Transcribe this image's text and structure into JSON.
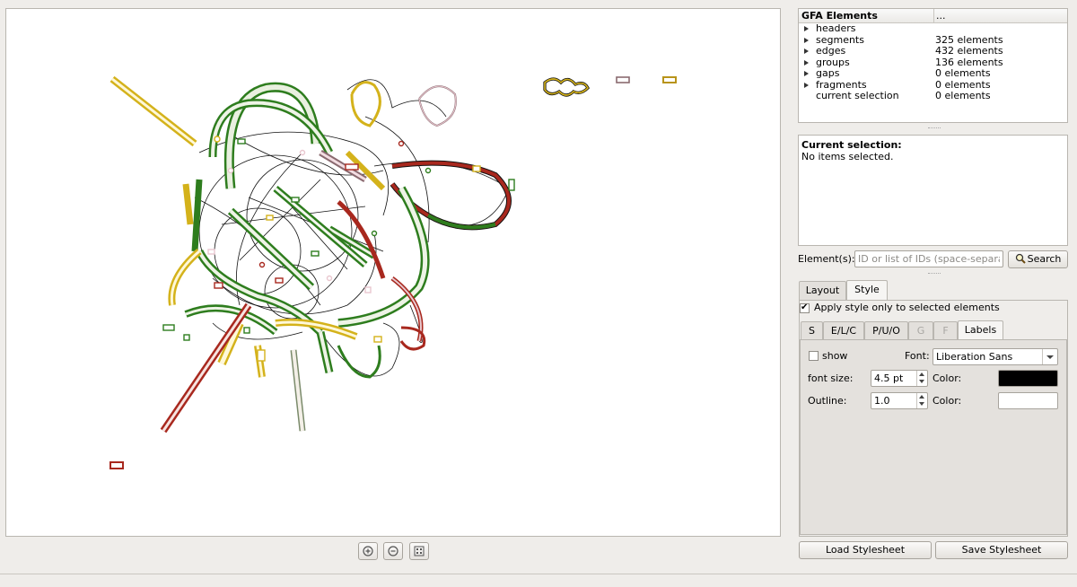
{
  "tree": {
    "header_col1": "GFA Elements",
    "header_col2": "...",
    "rows": [
      {
        "label": "headers",
        "count": "",
        "expandable": true
      },
      {
        "label": "segments",
        "count": "325 elements",
        "expandable": true
      },
      {
        "label": "edges",
        "count": "432 elements",
        "expandable": true
      },
      {
        "label": "groups",
        "count": "136 elements",
        "expandable": true
      },
      {
        "label": "gaps",
        "count": "0 elements",
        "expandable": true
      },
      {
        "label": "fragments",
        "count": "0 elements",
        "expandable": true
      },
      {
        "label": "current selection",
        "count": "0 elements",
        "expandable": false
      }
    ]
  },
  "selection": {
    "title": "Current selection:",
    "text": "No items selected."
  },
  "search": {
    "label": "Element(s):",
    "placeholder": "ID or list of IDs (space-separa...",
    "button": "Search"
  },
  "main_tabs": {
    "layout": "Layout",
    "style": "Style",
    "active": "Style"
  },
  "apply_style": {
    "label": "Apply style only to selected elements",
    "checked": true
  },
  "sub_tabs": {
    "s": "S",
    "elc": "E/L/C",
    "puo": "P/U/O",
    "g": "G",
    "f": "F",
    "labels": "Labels",
    "active": "Labels"
  },
  "labels_tab": {
    "show_label": "show",
    "show_checked": false,
    "font_label": "Font:",
    "font_value": "Liberation Sans",
    "font_size_label": "font size:",
    "font_size_value": "4.5 pt",
    "color_label": "Color:",
    "color_value": "#000000",
    "outline_label": "Outline:",
    "outline_value": "1.0",
    "outline_color_label": "Color:",
    "outline_color_value": "#ffffff"
  },
  "buttons": {
    "load": "Load Stylesheet",
    "save": "Save Stylesheet"
  },
  "graph_colors": {
    "green": "#2e7d1e",
    "yellow": "#d4b21b",
    "red": "#a8281e",
    "pink": "#e9c7cf",
    "edge": "#111111"
  }
}
